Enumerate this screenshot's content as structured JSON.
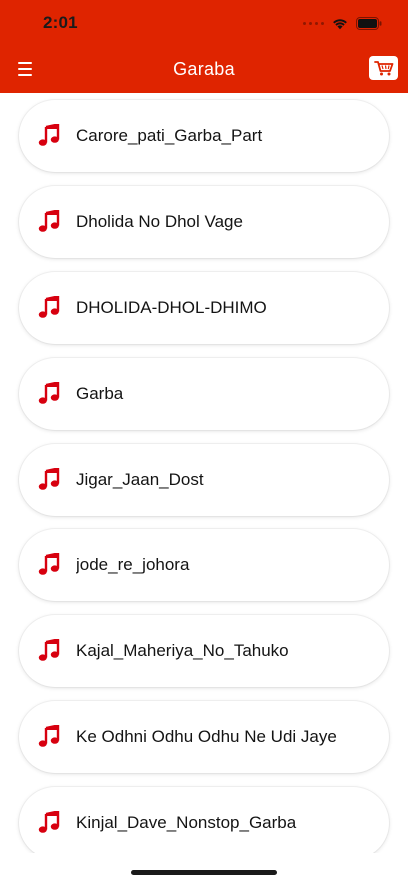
{
  "status_bar": {
    "time": "2:01"
  },
  "header": {
    "title": "Garaba",
    "background_color": "#df2400"
  },
  "icons": {
    "menu": "hamburger-menu-icon",
    "cart": "shopping-cart-icon",
    "song": "music-note-icon"
  },
  "songs": [
    "Carore_pati_Garba_Part",
    "Dholida No Dhol Vage",
    "DHOLIDA-DHOL-DHIMO",
    "Garba",
    "Jigar_Jaan_Dost",
    "jode_re_johora",
    "Kajal_Maheriya_No_Tahuko",
    "Ke Odhni Odhu Odhu Ne Udi Jaye",
    "Kinjal_Dave_Nonstop_Garba"
  ],
  "accent_color": "#d7000f"
}
